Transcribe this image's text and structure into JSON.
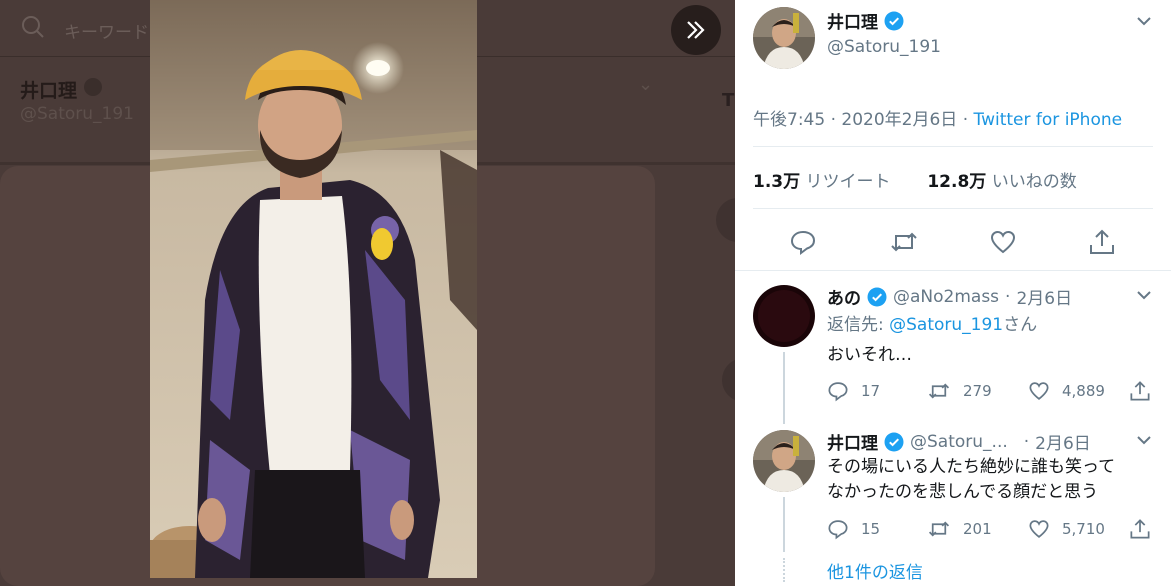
{
  "background": {
    "search_placeholder": "キーワード",
    "user_name": "井口理",
    "user_handle": "@Satoru_191",
    "letter": "T"
  },
  "main_tweet": {
    "name": "井口理",
    "handle": "@Satoru_191",
    "time": "午後7:45",
    "date": "2020年2月6日",
    "source": "Twitter for iPhone",
    "retweets": "1.3万",
    "retweets_label": "リツイート",
    "likes": "12.8万",
    "likes_label": "いいねの数"
  },
  "replies": [
    {
      "name": "あの",
      "handle": "@aNo2mass",
      "date": "2月6日",
      "reply_to_prefix": "返信先: ",
      "reply_to_handle": "@Satoru_191",
      "reply_to_suffix": "さん",
      "text": "おいそれ…",
      "replies": "17",
      "retweets": "279",
      "likes": "4,889"
    },
    {
      "name": "井口理",
      "handle": "@Satoru_...",
      "date": "2月6日",
      "text_line1": "その場にいる人たち絶妙に誰も笑って",
      "text_line2": "なかったのを悲しんでる顔だと思う",
      "replies": "15",
      "retweets": "201",
      "likes": "5,710"
    }
  ],
  "more_replies": "他1件の返信",
  "colors": {
    "accent": "#1b95e0",
    "verified": "#1da1f2",
    "text": "#14171a",
    "muted": "#657786"
  }
}
